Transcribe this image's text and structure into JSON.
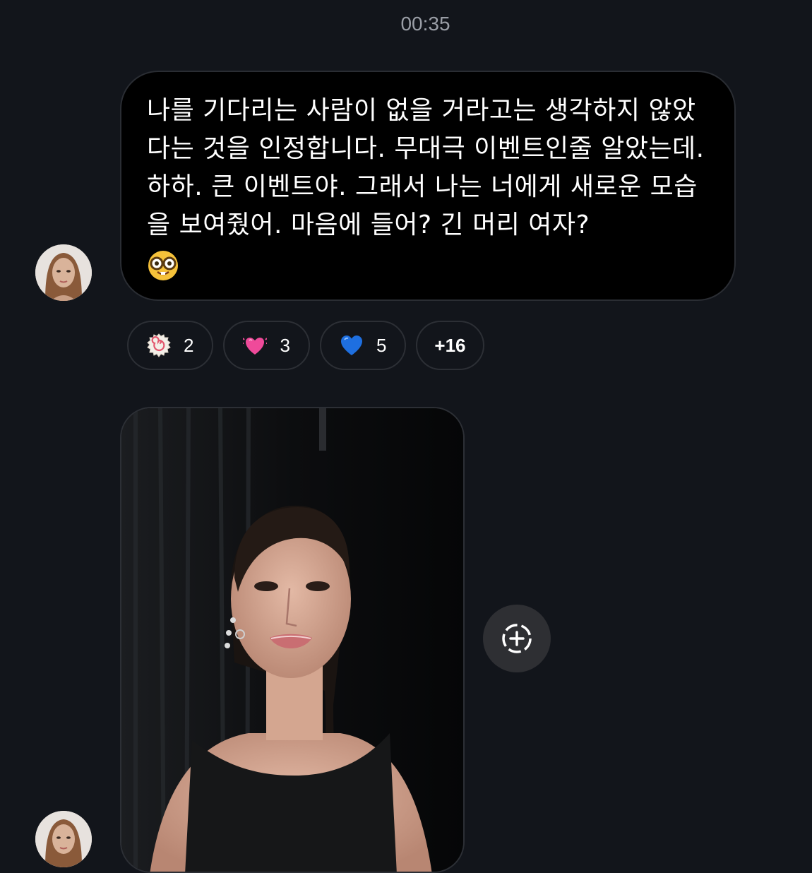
{
  "timestamp": "00:35",
  "message": {
    "text": "나를 기다리는 사람이 없을 거라고는 생각하지 않았다는 것을 인정합니다. 무대극 이벤트인줄 알았는데. 하하. 큰 이벤트야. 그래서 나는 너에게 새로운 모습을 보여줬어. 마음에 들어? 긴 머리 여자?",
    "trailing_emoji": "nerd-face-icon"
  },
  "reactions": [
    {
      "icon": "fish-cake-icon",
      "count": "2"
    },
    {
      "icon": "beating-heart-icon",
      "count": "3"
    },
    {
      "icon": "blue-heart-icon",
      "count": "5"
    }
  ],
  "more_reactions": "+16",
  "colors": {
    "background": "#12151b",
    "bubble": "#000000",
    "timestamp": "#9a9ea6",
    "blue_heart": "#1e6fe0",
    "pink_heart": "#ef4a9a"
  }
}
